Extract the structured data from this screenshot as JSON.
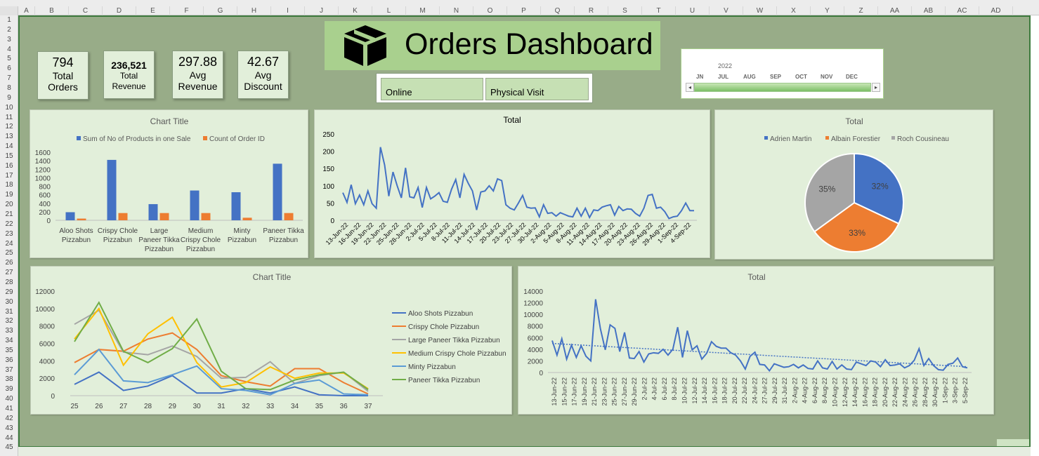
{
  "sheet": {
    "columns": [
      "A",
      "B",
      "C",
      "D",
      "E",
      "F",
      "G",
      "H",
      "I",
      "J",
      "K",
      "L",
      "M",
      "N",
      "O",
      "P",
      "Q",
      "R",
      "S",
      "T",
      "U",
      "V",
      "W",
      "X",
      "Y",
      "Z",
      "AA",
      "AB",
      "AC",
      "AD"
    ],
    "rows": [
      "1",
      "2",
      "3",
      "4",
      "5",
      "6",
      "7",
      "8",
      "9",
      "10",
      "11",
      "12",
      "13",
      "14",
      "15",
      "16",
      "17",
      "18",
      "19",
      "20",
      "21",
      "22",
      "23",
      "24",
      "25",
      "26",
      "27",
      "28",
      "29",
      "30",
      "31",
      "32",
      "33",
      "34",
      "35",
      "36",
      "37",
      "38",
      "39",
      "40",
      "41",
      "42",
      "43",
      "44",
      "45"
    ]
  },
  "header": {
    "title": "Orders Dashboard",
    "icon": "box-icon"
  },
  "kpis": [
    {
      "value": "794",
      "label1": "Total",
      "label2": "Orders"
    },
    {
      "value": "236,521",
      "label1": "Total",
      "label2": "Revenue"
    },
    {
      "value": "297.88",
      "label1": "Avg",
      "label2": "Revenue"
    },
    {
      "value": "42.67",
      "label1": "Avg",
      "label2": "Discount"
    }
  ],
  "slicer": {
    "items": [
      "Online",
      "Physical Visit"
    ]
  },
  "timeline": {
    "year": "2022",
    "months": [
      "JN",
      "JUL",
      "AUG",
      "SEP",
      "OCT",
      "NOV",
      "DEC"
    ],
    "left_arrow": "◂",
    "right_arrow": "▸"
  },
  "colors": {
    "blue": "#4472c4",
    "orange": "#ed7d31",
    "gray": "#a5a5a5",
    "yellow": "#ffc000",
    "lightblue": "#5b9bd5",
    "green": "#70ad47",
    "canvas": "#98ac88",
    "panel": "#e2efda"
  },
  "chart_data": [
    {
      "type": "bar",
      "title": "Chart Title",
      "categories": [
        [
          "Aloo Shots",
          "Pizzabun"
        ],
        [
          "Crispy Chole",
          "Pizzabun"
        ],
        [
          "Large",
          "Paneer Tikka",
          "Pizzabun"
        ],
        [
          "Medium",
          "Crispy Chole",
          "Pizzabun"
        ],
        [
          "Minty",
          "Pizzabun"
        ],
        [
          "Paneer Tikka",
          "Pizzabun"
        ]
      ],
      "series": [
        {
          "name": "Sum of No of Products in one Sale",
          "values": [
            190,
            1420,
            380,
            700,
            660,
            1330
          ]
        },
        {
          "name": "Count of Order ID",
          "values": [
            40,
            170,
            170,
            170,
            60,
            170
          ]
        }
      ],
      "ylim": [
        0,
        1600
      ],
      "yticks": [
        "0",
        "200",
        "400",
        "600",
        "800",
        "1000",
        "1200",
        "1400",
        "1600"
      ],
      "legend": "top"
    },
    {
      "type": "line",
      "title": "Total",
      "xticks": [
        "13-Jun-22",
        "16-Jun-22",
        "19-Jun-22",
        "22-Jun-22",
        "25-Jun-22",
        "28-Jun-22",
        "2-Jul-22",
        "5-Jul-22",
        "8-Jul-22",
        "11-Jul-22",
        "14-Jul-22",
        "17-Jul-22",
        "20-Jul-22",
        "23-Jul-22",
        "27-Jul-22",
        "30-Jul-22",
        "2-Aug-22",
        "5-Aug-22",
        "8-Aug-22",
        "11-Aug-22",
        "14-Aug-22",
        "17-Aug-22",
        "20-Aug-22",
        "23-Aug-22",
        "26-Aug-22",
        "29-Aug-22",
        "1-Sep-22",
        "4-Sep-22"
      ],
      "values": [
        80,
        52,
        103,
        48,
        73,
        45,
        85,
        48,
        35,
        212,
        160,
        70,
        140,
        100,
        65,
        152,
        68,
        65,
        95,
        37,
        95,
        62,
        70,
        80,
        55,
        52,
        90,
        118,
        65,
        133,
        107,
        85,
        30,
        82,
        85,
        100,
        85,
        120,
        115,
        45,
        35,
        30,
        50,
        72,
        38,
        35,
        36,
        10,
        45,
        20,
        22,
        12,
        22,
        17,
        12,
        10,
        35,
        12,
        35,
        8,
        30,
        28,
        38,
        42,
        45,
        15,
        40,
        28,
        33,
        32,
        20,
        12,
        35,
        72,
        75,
        35,
        38,
        25,
        5,
        10,
        12,
        28,
        50,
        28,
        28
      ],
      "ylim": [
        0,
        250
      ],
      "yticks": [
        "0",
        "50",
        "100",
        "150",
        "200",
        "250"
      ]
    },
    {
      "type": "pie",
      "title": "Total",
      "labels": [
        "Adrien Martin",
        "Albain Forestier",
        "Roch Cousineau"
      ],
      "values": [
        32,
        33,
        35
      ],
      "value_labels": [
        "32%",
        "33%",
        "35%"
      ],
      "legend": "top"
    },
    {
      "type": "line",
      "title": "Chart Title",
      "categories": [
        "25",
        "26",
        "27",
        "28",
        "29",
        "30",
        "31",
        "32",
        "33",
        "34",
        "35",
        "36",
        "37"
      ],
      "series": [
        {
          "name": "Aloo Shots Pizzabun",
          "values": [
            1300,
            2700,
            600,
            1100,
            2300,
            300,
            300,
            800,
            300,
            1000,
            100,
            0,
            0
          ]
        },
        {
          "name": "Crispy Chole Pizzabun",
          "values": [
            3800,
            5300,
            5100,
            6500,
            7200,
            5300,
            2300,
            1600,
            1100,
            3100,
            3100,
            1500,
            200
          ]
        },
        {
          "name": "Large Paneer Tikka Pizzabun",
          "values": [
            8200,
            9800,
            5000,
            4700,
            5700,
            4500,
            2000,
            2100,
            3900,
            1400,
            2300,
            2700,
            500
          ]
        },
        {
          "name": "Medium Crispy Chole Pizzabun",
          "values": [
            6500,
            10000,
            3500,
            7100,
            9000,
            3800,
            1000,
            1500,
            3300,
            2000,
            2600,
            2600,
            800
          ]
        },
        {
          "name": "Minty Pizzabun",
          "values": [
            2400,
            5300,
            1700,
            1500,
            2400,
            3400,
            800,
            600,
            100,
            1400,
            1800,
            200,
            100
          ]
        },
        {
          "name": "Paneer Tikka Pizzabun",
          "values": [
            6200,
            10700,
            5100,
            3800,
            5400,
            8800,
            2800,
            800,
            700,
            1800,
            2400,
            2700,
            700
          ]
        }
      ],
      "ylim": [
        0,
        12000
      ],
      "yticks": [
        "0",
        "2000",
        "4000",
        "6000",
        "8000",
        "10000",
        "12000"
      ],
      "legend": "right"
    },
    {
      "type": "line",
      "title": "Total",
      "trendline": "linear, dotted",
      "xticks": [
        "13-Jun-22",
        "15-Jun-22",
        "17-Jun-22",
        "19-Jun-22",
        "21-Jun-22",
        "23-Jun-22",
        "25-Jun-22",
        "27-Jun-22",
        "29-Jun-22",
        "2-Jul-22",
        "4-Jul-22",
        "6-Jul-22",
        "8-Jul-22",
        "10-Jul-22",
        "12-Jul-22",
        "14-Jul-22",
        "16-Jul-22",
        "18-Jul-22",
        "20-Jul-22",
        "22-Jul-22",
        "24-Jul-22",
        "27-Jul-22",
        "29-Jul-22",
        "31-Jul-22",
        "2-Aug-22",
        "4-Aug-22",
        "6-Aug-22",
        "8-Aug-22",
        "10-Aug-22",
        "12-Aug-22",
        "14-Aug-22",
        "16-Aug-22",
        "18-Aug-22",
        "20-Aug-22",
        "22-Aug-22",
        "24-Aug-22",
        "26-Aug-22",
        "28-Aug-22",
        "30-Aug-22",
        "1-Sep-22",
        "3-Sep-22",
        "5-Sep-22"
      ],
      "values": [
        5500,
        3000,
        5800,
        2300,
        4700,
        2600,
        4600,
        2800,
        2000,
        12600,
        7500,
        3900,
        8200,
        7600,
        3600,
        6900,
        2500,
        2400,
        3600,
        1800,
        3200,
        3400,
        3300,
        4000,
        3000,
        4000,
        7800,
        2600,
        7200,
        3900,
        4600,
        2300,
        3300,
        5300,
        4500,
        4200,
        4200,
        3400,
        3000,
        2000,
        600,
        2800,
        3500,
        1400,
        1300,
        300,
        1500,
        1200,
        900,
        1000,
        1400,
        800,
        1300,
        700,
        600,
        2000,
        800,
        600,
        1900,
        600,
        1300,
        600,
        500,
        1800,
        1500,
        1200,
        2000,
        1800,
        1000,
        2200,
        1200,
        1300,
        1500,
        800,
        1200,
        2100,
        4100,
        1200,
        2400,
        1200,
        500,
        400,
        1400,
        1600,
        2500,
        1000,
        800
      ],
      "trend": [
        5000,
        1000
      ],
      "ylim": [
        0,
        14000
      ],
      "yticks": [
        "0",
        "2000",
        "4000",
        "6000",
        "8000",
        "10000",
        "12000",
        "14000"
      ]
    }
  ]
}
